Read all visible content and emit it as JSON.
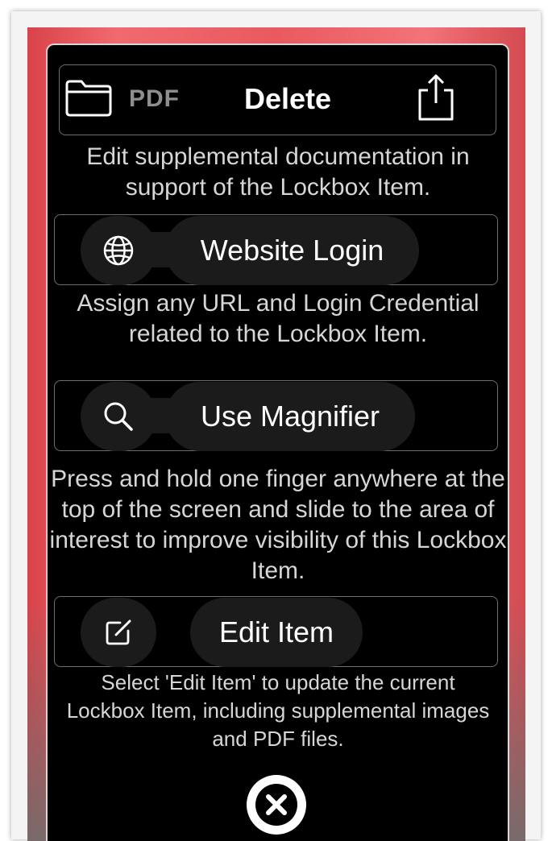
{
  "toolbar": {
    "folder_icon": "folder-icon",
    "pdf_label": "PDF",
    "delete_label": "Delete",
    "share_icon": "share-icon"
  },
  "sections": [
    {
      "description": "Edit supplemental documentation in support of the Lockbox Item."
    },
    {
      "icon": "globe-icon",
      "label": "Website Login",
      "description": "Assign any URL and Login Credential related to the Lockbox Item."
    },
    {
      "icon": "magnifier-icon",
      "label": "Use Magnifier",
      "description": "Press and hold one finger anywhere at the top of the screen and slide to the area of interest to improve visibility of this Lockbox Item."
    },
    {
      "icon": "edit-icon",
      "label": "Edit Item",
      "description": "Select 'Edit Item' to update the current Lockbox Item, including supplemental images and PDF files."
    }
  ],
  "close_icon": "close-icon",
  "colors": {
    "background_red": "#e85a60",
    "panel": "#000000",
    "text": "#d6d6d6"
  }
}
